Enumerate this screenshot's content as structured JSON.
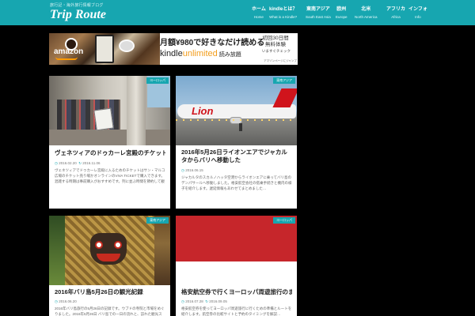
{
  "site": {
    "tagline": "旅行記・海外旅行情報ブログ",
    "title": "Trip Route",
    "colors": {
      "accent": "#17a6b0",
      "background": "#000000",
      "card": "#ffffff"
    }
  },
  "nav": {
    "items": [
      {
        "jp": "ホーム",
        "en": "Home"
      },
      {
        "jp": "kindleとは？",
        "en": "What is a Kindle?"
      },
      {
        "jp": "東南アジア",
        "en": "South East Asia"
      },
      {
        "jp": "欧州",
        "en": "Europe"
      },
      {
        "jp": "北米",
        "en": "North America"
      },
      {
        "jp": "アフリカ",
        "en": "Africa"
      },
      {
        "jp": "インフォ",
        "en": "Info"
      }
    ]
  },
  "banner": {
    "brand": "amazon",
    "headline": "月額¥980で好きなだけ読める",
    "kindle_prefix": "kindle",
    "kindle_suffix": "unlimited",
    "yomihoudai": "読み放題",
    "side_line1": "初回30日間",
    "side_line2": "無料体験",
    "cta": "いますぐチェック",
    "note": "アマゾンページにジャンプ"
  },
  "cards": [
    {
      "badge": "ヨーロッパ",
      "title": "ヴェネツィアのドゥカーレ宮殿のチケット購入方法",
      "date": "2016.02.20",
      "updated": "2016.11.06",
      "excerpt": "ヴェネツィアでドゥカーレ宮殿に入るためのチケットはサン・マルコ広場のチケット売り場かオンラインのVIVA TICKETで購入できます。混雑する時期は事前購入がおすすめです。列に並ぶ時間を節約して観光を楽しみましょう…"
    },
    {
      "badge": "東南アジア",
      "title": "2016年5月26日ライオンエアでジャカルタからバリへ移動した",
      "date": "2016.06.15",
      "updated": "",
      "excerpt": "ジャカルタのスカルノハッタ空港からライオンエアに乗ってバリ島のデンパサールへ移動しました。格安航空会社の搭乗手続きと機内の様子を紹介します。遅延情報もあわせてまとめました…"
    },
    {
      "badge": "東南アジア",
      "title": "2016年バリ島5月26日の観光記録",
      "date": "2016.06.20",
      "updated": "",
      "excerpt": "2016年バリ島旅行の5月26日の記録です。ウブドの寺院と市場をめぐりました。2016年5月26日 バリ島での一日の流れと、訪れた観光スポットの感想を写真とともにまとめています…"
    },
    {
      "badge": "ヨーロッパ",
      "title": "格安航空券で行くヨーロッパ周遊旅行のまとめ",
      "date": "2016.07.28",
      "updated": "2016.09.05",
      "excerpt": "格安航空券を使ってヨーロッパ周遊旅行に行くための準備とルートを紹介します。航空券の比較サイトと予約のタイミングを解説…"
    }
  ]
}
